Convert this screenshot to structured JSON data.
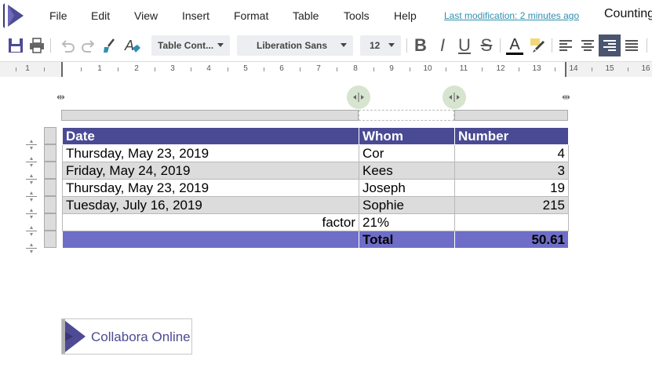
{
  "menu": {
    "items": [
      "File",
      "Edit",
      "View",
      "Insert",
      "Format",
      "Table",
      "Tools",
      "Help"
    ],
    "last_modification_label": "Last modification:",
    "last_modification_value": "2 minutes ago",
    "doc_title": "Counting"
  },
  "toolbar": {
    "paragraph_style": "Table Cont...",
    "font_name": "Liberation Sans",
    "font_size": "12",
    "bold": "B",
    "italic": "I",
    "underline": "U",
    "strike": "S",
    "font_color_glyph": "A",
    "accent_color": "#4a4a94"
  },
  "ruler": {
    "labels": [
      "1",
      "1",
      "1",
      "2",
      "3",
      "4",
      "5",
      "6",
      "7",
      "8",
      "9",
      "10",
      "11",
      "12",
      "13",
      "14",
      "15",
      "16"
    ]
  },
  "table": {
    "headers": [
      "Date",
      "Whom",
      "Number"
    ],
    "rows": [
      [
        "Thursday, May 23, 2019",
        "Cor",
        "4"
      ],
      [
        "Friday, May 24, 2019",
        "Kees",
        "3"
      ],
      [
        "Thursday, May 23, 2019",
        "Joseph",
        "19"
      ],
      [
        "Tuesday, July 16, 2019",
        "Sophie",
        "215"
      ],
      [
        "factor",
        "21%",
        ""
      ]
    ],
    "total": [
      "",
      "Total",
      "50.61"
    ],
    "header_color": "#4a4a94",
    "total_color": "#6e6ec8",
    "stripe_color": "#dcdcdc"
  },
  "brand": {
    "name": "Collabora Online",
    "color": "#4e4a94"
  }
}
